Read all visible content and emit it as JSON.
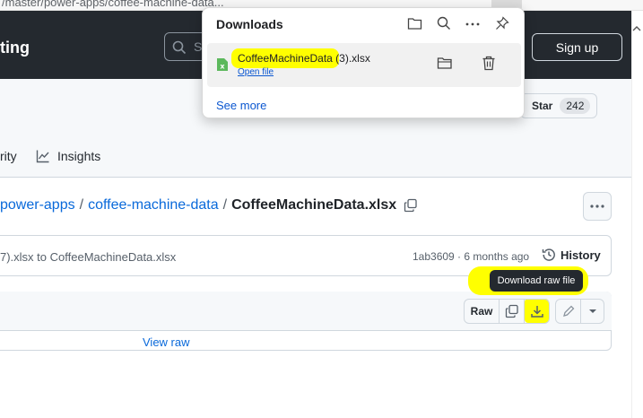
{
  "browser": {
    "url_fragment": "/master/power-apps/coffee-machine-data..."
  },
  "header": {
    "brand_partial": "ting",
    "search_placeholder_partial": "S",
    "signup_label": "Sign up"
  },
  "repo": {
    "star_label": "Star",
    "star_count": "242",
    "nav_security_partial": "rity",
    "nav_insights": "Insights"
  },
  "breadcrumb": {
    "part1": "power-apps",
    "sep": "/",
    "part2": "coffee-machine-data",
    "file": "CoffeeMachineData.xlsx"
  },
  "commit": {
    "message_partial": "7).xlsx to CoffeeMachineData.xlsx",
    "meta": "1ab3609 · 6 months ago",
    "history_label": "History"
  },
  "file_toolbar": {
    "raw_label": "Raw",
    "tooltip": "Download raw file",
    "view_raw": "View raw"
  },
  "downloads": {
    "title": "Downloads",
    "item_name": "CoffeeMachineData (3).xlsx",
    "item_action": "Open file",
    "see_more": "See more"
  },
  "colors": {
    "highlight": "#ffff00",
    "github_header": "#24292f",
    "link_blue": "#0969da",
    "excel_green": "#5cb85c"
  }
}
